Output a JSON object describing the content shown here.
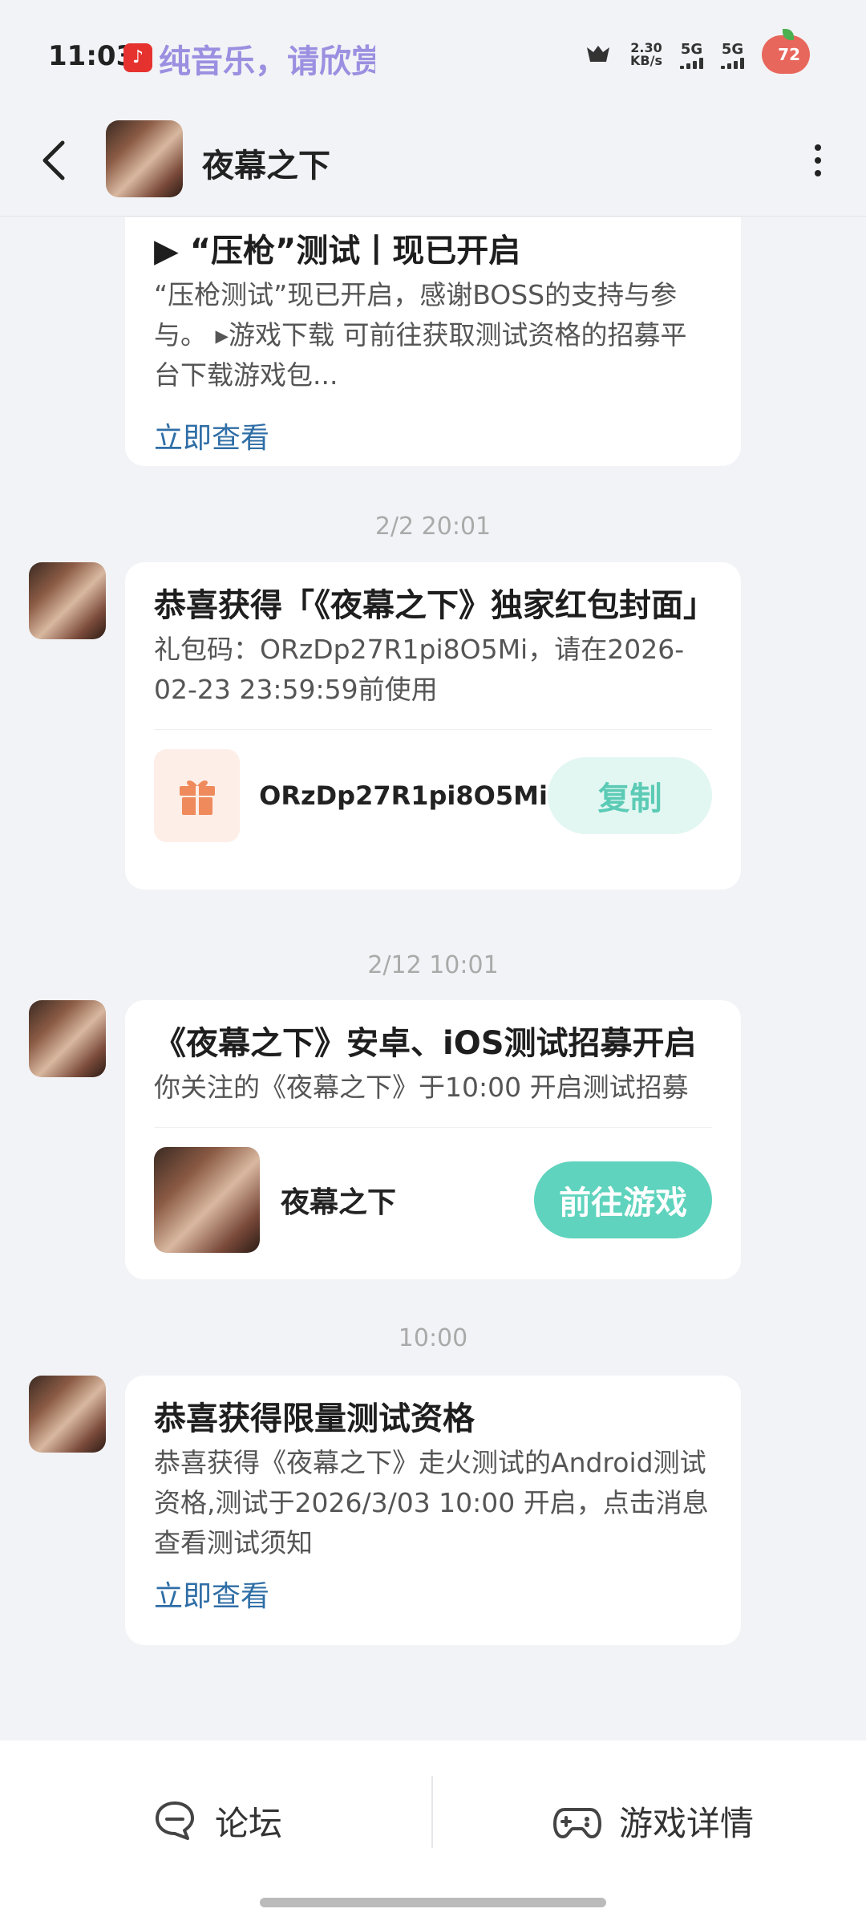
{
  "status_bar": {
    "time": "11:03",
    "music_text": "纯音乐，请欣赏",
    "net_speed": "2.30",
    "net_unit": "KB/s",
    "sig1": "5G",
    "sig2": "5G",
    "battery": "72"
  },
  "header": {
    "title": "夜幕之下"
  },
  "messages": [
    {
      "title": "▶ “压枪”测试丨现已开启",
      "desc": "“压枪测试”现已开启，感谢BOSS的支持与参与。 ▸游戏下载 可前往获取测试资格的招募平台下载游戏包...",
      "link": "立即查看"
    },
    {
      "timestamp": "2/2  20:01",
      "title": "恭喜获得「《夜幕之下》独家红包封面」",
      "desc": "礼包码：ORzDp27R1pi8O5Mi，请在2026-02-23 23:59:59前使用",
      "code": "ORzDp27R1pi8O5Mi",
      "button": "复制"
    },
    {
      "timestamp": "2/12  10:01",
      "title": "《夜幕之下》安卓、iOS测试招募开启",
      "desc": "你关注的《夜幕之下》于10:00 开启测试招募",
      "game_name": "夜幕之下",
      "button": "前往游戏"
    },
    {
      "timestamp": "10:00",
      "title": "恭喜获得限量测试资格",
      "desc": "恭喜获得《夜幕之下》走火测试的Android测试资格,测试于2026/3/03 10:00 开启，点击消息查看测试须知",
      "link": "立即查看"
    }
  ],
  "bottom_bar": {
    "forum": "论坛",
    "game_detail": "游戏详情"
  },
  "colors": {
    "accent": "#5fd3bd",
    "link": "#2f6ea6",
    "gift": "#ef8a5c"
  }
}
